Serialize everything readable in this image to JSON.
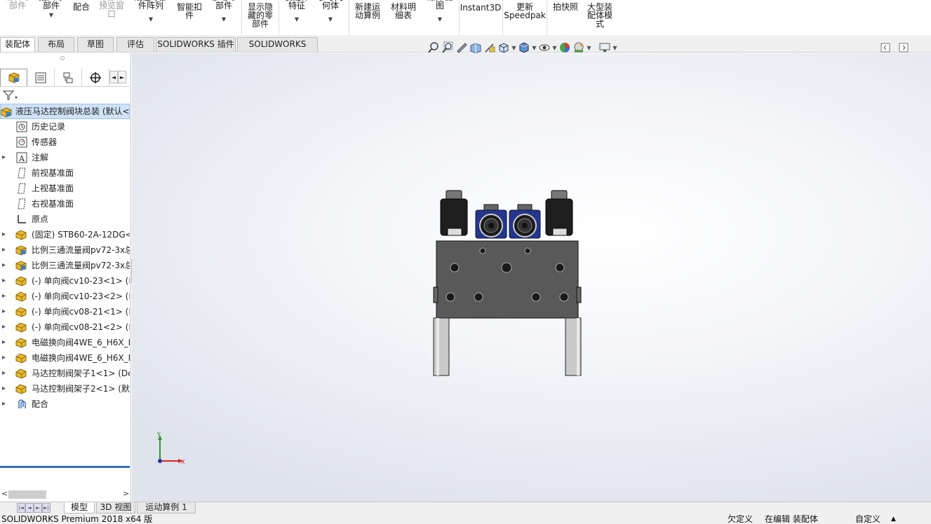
{
  "ribbon": {
    "buttons": [
      {
        "label": "编辑零\n部件",
        "disabled": true
      },
      {
        "label": "插入零\n部件",
        "caret": true
      },
      {
        "label": "配合"
      },
      {
        "label": "零部件\n预览窗\n口",
        "disabled": true
      },
      {
        "label": "线性零部\n件阵列",
        "caret": true
      },
      {
        "label": "智能扣\n件"
      },
      {
        "label": "移动零\n部件",
        "caret": true
      },
      {
        "label": "显示隐\n藏的零\n部件"
      },
      {
        "label": "装配体\n特征",
        "caret": true
      },
      {
        "label": "参考几\n何体",
        "caret": true
      },
      {
        "label": "新建运\n动算例"
      },
      {
        "label": "材料明\n细表"
      },
      {
        "label": "爆炸视\n图",
        "caret": true
      },
      {
        "label": "Instant3D"
      },
      {
        "label": "更新\nSpeedpak"
      },
      {
        "label": "拍快照"
      },
      {
        "label": "大型装\n配体模\n式"
      }
    ]
  },
  "command_tabs": [
    "装配体",
    "布局",
    "草图",
    "评估",
    "SOLIDWORKS 插件",
    "SOLIDWORKS MBD"
  ],
  "heads_up_icons": [
    "zoom-to-fit-icon",
    "zoom-area-icon",
    "previous-view-icon",
    "section-view-icon",
    "dynamic-annotation-icon",
    "view-orientation-icon",
    "display-style-icon",
    "hide-show-items-icon",
    "edit-appearance-icon",
    "apply-scene-icon",
    "view-settings-icon"
  ],
  "panel": {
    "tabs": [
      "featuremanager-icon",
      "propertymanager-icon",
      "configurationmanager-icon",
      "dimxpertmanager-icon"
    ],
    "root": "液压马达控制阀块总装  (默认<",
    "items": [
      {
        "label": "历史记录",
        "icon": "history-icon",
        "expand": false
      },
      {
        "label": "传感器",
        "icon": "sensor-icon",
        "expand": false
      },
      {
        "label": "注解",
        "icon": "annotation-icon",
        "expand": true
      },
      {
        "label": "前视基准面",
        "icon": "plane-icon",
        "expand": false
      },
      {
        "label": "上视基准面",
        "icon": "plane-icon",
        "expand": false
      },
      {
        "label": "右视基准面",
        "icon": "plane-icon",
        "expand": false
      },
      {
        "label": "原点",
        "icon": "origin-icon",
        "expand": false
      },
      {
        "label": "(固定) STB60-2A-12DG<",
        "icon": "part-icon",
        "expand": true
      },
      {
        "label": "比例三通流量阀pv72-3x总",
        "icon": "subassembly-icon",
        "expand": true
      },
      {
        "label": "比例三通流量阀pv72-3x总",
        "icon": "subassembly-icon",
        "expand": true
      },
      {
        "label": "(-) 单向阀cv10-23<1> (D",
        "icon": "part-icon",
        "expand": true
      },
      {
        "label": "(-) 单向阀cv10-23<2> (D",
        "icon": "part-icon",
        "expand": true
      },
      {
        "label": "(-) 单向阀cv08-21<1> (D",
        "icon": "part-icon",
        "expand": true
      },
      {
        "label": "(-) 单向阀cv08-21<2> (D",
        "icon": "part-icon",
        "expand": true
      },
      {
        "label": "电磁换向阀4WE_6_H6X_E",
        "icon": "part-icon",
        "expand": true
      },
      {
        "label": "电磁换向阀4WE_6_H6X_E",
        "icon": "part-icon",
        "expand": true
      },
      {
        "label": "马达控制阀架子1<1> (De",
        "icon": "part-icon",
        "expand": true
      },
      {
        "label": "马达控制阀架子2<1> (默认",
        "icon": "part-icon",
        "expand": true
      },
      {
        "label": "配合",
        "icon": "mates-icon",
        "expand": true
      }
    ]
  },
  "triad": {
    "y": "Y",
    "x": "X"
  },
  "bottom_tabs": [
    "模型",
    "3D 视图",
    "运动算例 1"
  ],
  "status": {
    "product": "SOLIDWORKS Premium 2018 x64 版",
    "definition": "欠定义",
    "editing": "在编辑 装配体",
    "units": "自定义",
    "units_caret": "▲"
  },
  "colors": {
    "accent": "#2f6fb7",
    "selection": "#cfe2f7",
    "part_yellow": "#e8b92e",
    "block_gray": "#595959",
    "coil_blue": "#24368c"
  }
}
